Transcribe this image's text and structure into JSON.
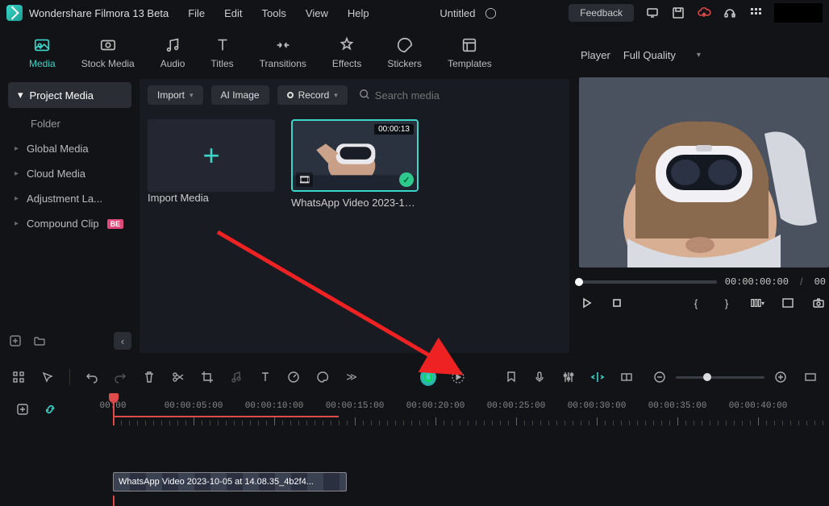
{
  "app": {
    "title": "Wondershare Filmora 13 Beta"
  },
  "menu": {
    "file": "File",
    "edit": "Edit",
    "tools": "Tools",
    "view": "View",
    "help": "Help"
  },
  "doc": {
    "title": "Untitled"
  },
  "feedback": {
    "label": "Feedback"
  },
  "tabs": {
    "media": "Media",
    "stock": "Stock Media",
    "audio": "Audio",
    "titles": "Titles",
    "transitions": "Transitions",
    "effects": "Effects",
    "stickers": "Stickers",
    "templates": "Templates"
  },
  "sidebar": {
    "project": "Project Media",
    "folder": "Folder",
    "global": "Global Media",
    "cloud": "Cloud Media",
    "adjustment": "Adjustment La...",
    "compound": "Compound Clip",
    "badge": "BE"
  },
  "mediabar": {
    "import": "Import",
    "aiimage": "AI Image",
    "record": "Record",
    "search_ph": "Search media"
  },
  "tiles": {
    "import_label": "Import Media",
    "clip1_label": "WhatsApp Video 2023-10-05...",
    "clip1_dur": "00:00:13"
  },
  "player": {
    "label": "Player",
    "quality": "Full Quality",
    "time_current": "00:00:00:00",
    "time_sep": "/",
    "time_total": "00"
  },
  "ruler": {
    "t0": "00:00",
    "t1": "00:00:05:00",
    "t2": "00:00:10:00",
    "t3": "00:00:15:00",
    "t4": "00:00:20:00",
    "t5": "00:00:25:00",
    "t6": "00:00:30:00",
    "t7": "00:00:35:00",
    "t8": "00:00:40:00"
  },
  "clip_strip": {
    "label": "WhatsApp Video 2023-10-05 at 14.08.35_4b2f4..."
  }
}
